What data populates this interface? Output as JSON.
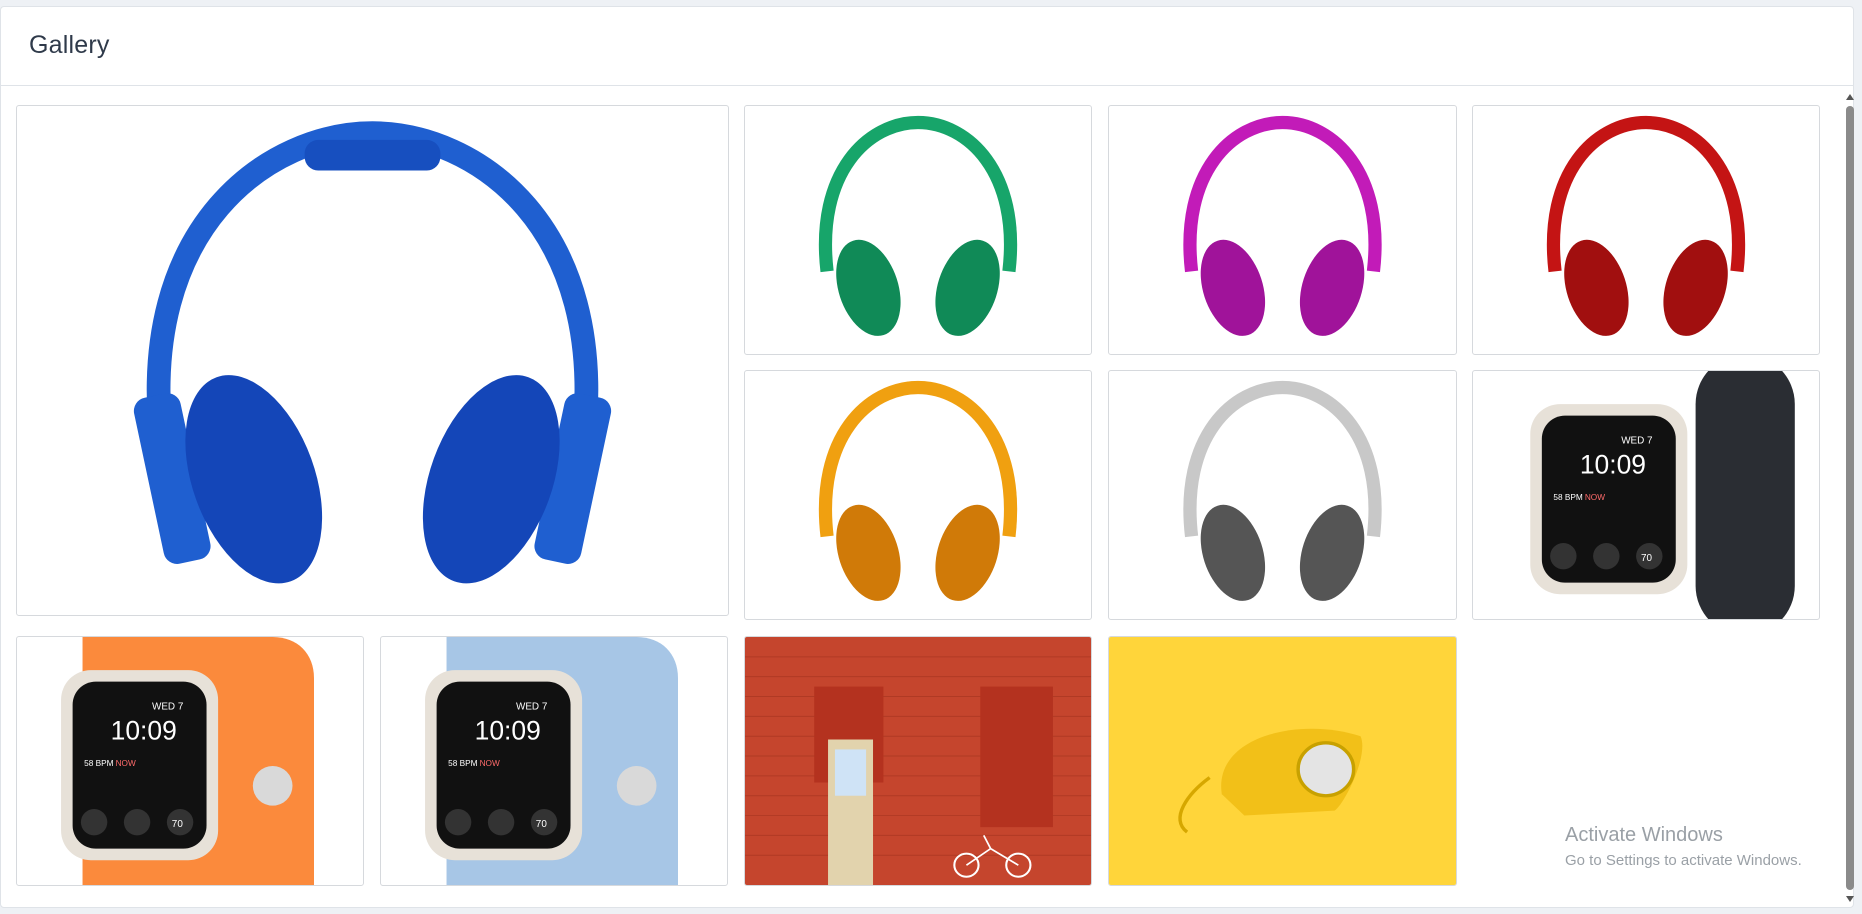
{
  "page": {
    "title": "Gallery"
  },
  "gallery": {
    "items": [
      {
        "name": "blue-headphones-image",
        "subject": "headphones",
        "color": "#1f5fd0"
      },
      {
        "name": "green-headphones-image",
        "subject": "headphones",
        "color": "#17a56a"
      },
      {
        "name": "magenta-headphones-image",
        "subject": "headphones",
        "color": "#c21bb8"
      },
      {
        "name": "red-headphones-image",
        "subject": "headphones",
        "color": "#c41414"
      },
      {
        "name": "orange-headphones-image",
        "subject": "headphones",
        "color": "#f0a010"
      },
      {
        "name": "silver-headphones-image",
        "subject": "headphones",
        "color": "#c8c8c8"
      },
      {
        "name": "black-watch-image",
        "subject": "smartwatch",
        "color": "#2a2d33"
      },
      {
        "name": "orange-watch-image",
        "subject": "smartwatch",
        "color": "#fb8a3c"
      },
      {
        "name": "lightblue-watch-image",
        "subject": "smartwatch",
        "color": "#a7c6e6"
      },
      {
        "name": "red-wall-door-image",
        "subject": "brick wall with door and bicycle",
        "color": "#c5452d"
      },
      {
        "name": "yellow-telephone-image",
        "subject": "rotary telephone",
        "color": "#ffd53a"
      }
    ]
  },
  "watch_face": {
    "date": "WED 7",
    "time": "10:09",
    "bpm": "58 BPM",
    "now": "NOW",
    "complication": "70"
  },
  "watermark": {
    "line1": "Activate Windows",
    "line2": "Go to Settings to activate Windows."
  }
}
